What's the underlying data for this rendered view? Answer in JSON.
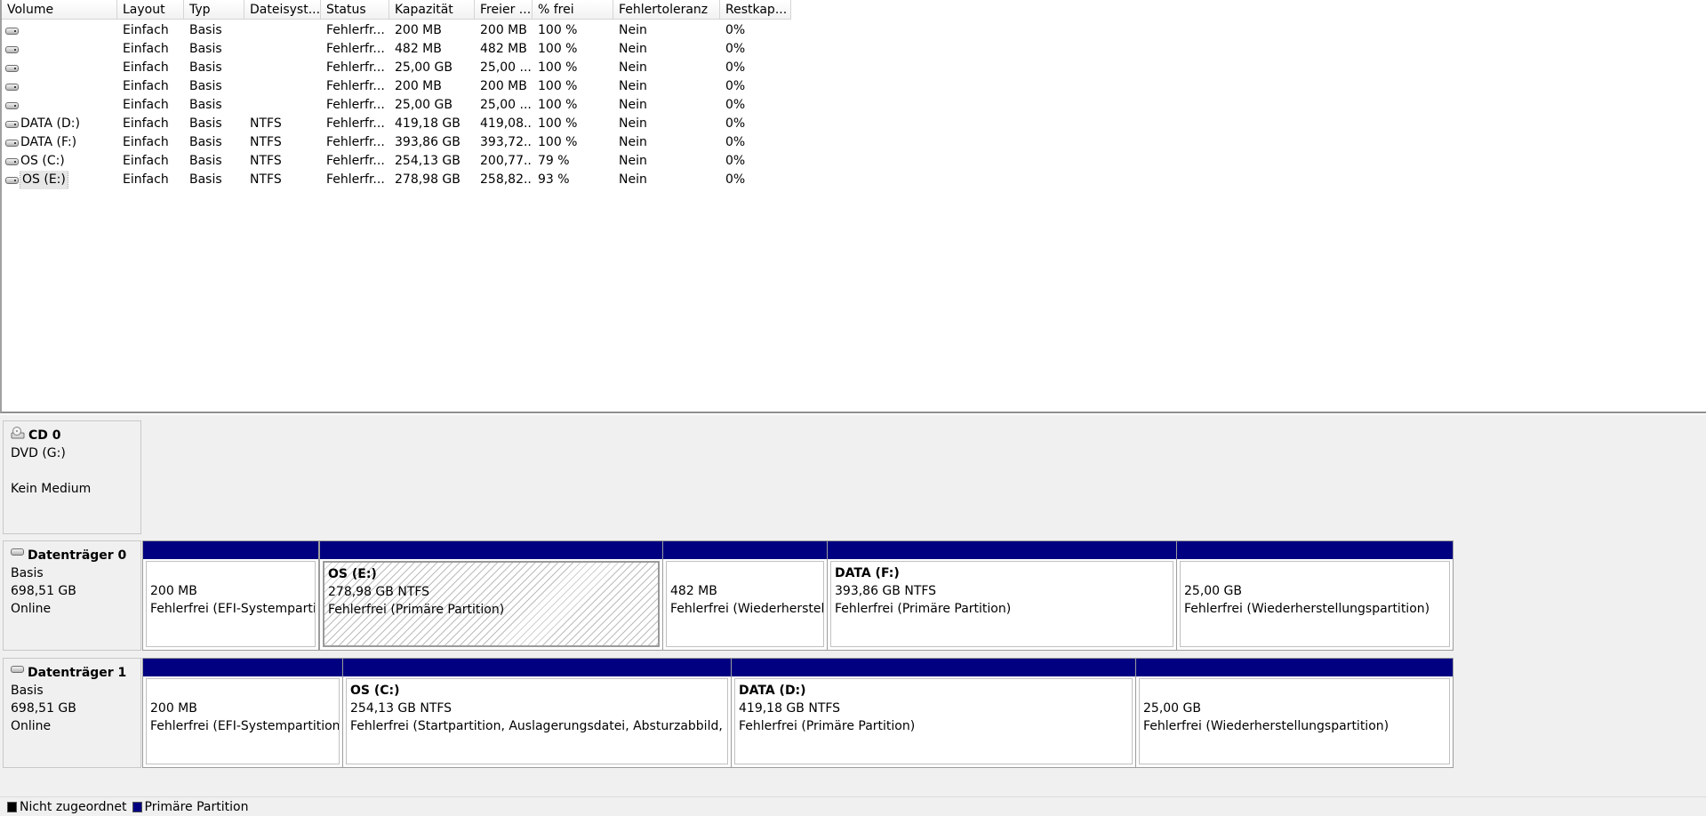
{
  "volume_table": {
    "columns": [
      "Volume",
      "Layout",
      "Typ",
      "Dateisyst...",
      "Status",
      "Kapazität",
      "Freier ...",
      "% frei",
      "Fehlertoleranz",
      "Restkap..."
    ],
    "rows": [
      {
        "volume": "",
        "layout": "Einfach",
        "typ": "Basis",
        "dateisystem": "",
        "status": "Fehlerfr...",
        "kapazitaet": "200 MB",
        "frei": "200 MB",
        "prozent": "100 %",
        "fehlertoleranz": "Nein",
        "restkap": "0%"
      },
      {
        "volume": "",
        "layout": "Einfach",
        "typ": "Basis",
        "dateisystem": "",
        "status": "Fehlerfr...",
        "kapazitaet": "482 MB",
        "frei": "482 MB",
        "prozent": "100 %",
        "fehlertoleranz": "Nein",
        "restkap": "0%"
      },
      {
        "volume": "",
        "layout": "Einfach",
        "typ": "Basis",
        "dateisystem": "",
        "status": "Fehlerfr...",
        "kapazitaet": "25,00 GB",
        "frei": "25,00 ...",
        "prozent": "100 %",
        "fehlertoleranz": "Nein",
        "restkap": "0%"
      },
      {
        "volume": "",
        "layout": "Einfach",
        "typ": "Basis",
        "dateisystem": "",
        "status": "Fehlerfr...",
        "kapazitaet": "200 MB",
        "frei": "200 MB",
        "prozent": "100 %",
        "fehlertoleranz": "Nein",
        "restkap": "0%"
      },
      {
        "volume": "",
        "layout": "Einfach",
        "typ": "Basis",
        "dateisystem": "",
        "status": "Fehlerfr...",
        "kapazitaet": "25,00 GB",
        "frei": "25,00 ...",
        "prozent": "100 %",
        "fehlertoleranz": "Nein",
        "restkap": "0%"
      },
      {
        "volume": "DATA (D:)",
        "layout": "Einfach",
        "typ": "Basis",
        "dateisystem": "NTFS",
        "status": "Fehlerfr...",
        "kapazitaet": "419,18 GB",
        "frei": "419,08...",
        "prozent": "100 %",
        "fehlertoleranz": "Nein",
        "restkap": "0%"
      },
      {
        "volume": "DATA (F:)",
        "layout": "Einfach",
        "typ": "Basis",
        "dateisystem": "NTFS",
        "status": "Fehlerfr...",
        "kapazitaet": "393,86 GB",
        "frei": "393,72...",
        "prozent": "100 %",
        "fehlertoleranz": "Nein",
        "restkap": "0%"
      },
      {
        "volume": "OS (C:)",
        "layout": "Einfach",
        "typ": "Basis",
        "dateisystem": "NTFS",
        "status": "Fehlerfr...",
        "kapazitaet": "254,13 GB",
        "frei": "200,77...",
        "prozent": "79 %",
        "fehlertoleranz": "Nein",
        "restkap": "0%"
      },
      {
        "volume": "OS (E:)",
        "layout": "Einfach",
        "typ": "Basis",
        "dateisystem": "NTFS",
        "status": "Fehlerfr...",
        "kapazitaet": "278,98 GB",
        "frei": "258,82...",
        "prozent": "93 %",
        "fehlertoleranz": "Nein",
        "restkap": "0%",
        "selected": true
      }
    ]
  },
  "disks": [
    {
      "name": "CD 0",
      "lines": [
        "DVD (G:)",
        "",
        "Kein Medium"
      ],
      "icon": "cd-drive-icon",
      "partitions": []
    },
    {
      "name": "Datenträger 0",
      "lines": [
        "Basis",
        "698,51 GB",
        "Online"
      ],
      "icon": "hard-disk-icon",
      "partitions": [
        {
          "title": "",
          "size": "200 MB",
          "status": "Fehlerfrei (EFI-Systempartiti"
        },
        {
          "title": "OS  (E:)",
          "size": "278,98 GB NTFS",
          "status": "Fehlerfrei (Primäre Partition)",
          "selected": true
        },
        {
          "title": "",
          "size": "482 MB",
          "status": "Fehlerfrei (Wiederherstellungspa"
        },
        {
          "title": "DATA  (F:)",
          "size": "393,86 GB NTFS",
          "status": "Fehlerfrei (Primäre Partition)"
        },
        {
          "title": "",
          "size": "25,00 GB",
          "status": "Fehlerfrei (Wiederherstellungspartition)"
        }
      ]
    },
    {
      "name": "Datenträger 1",
      "lines": [
        "Basis",
        "698,51 GB",
        "Online"
      ],
      "icon": "hard-disk-icon",
      "partitions": [
        {
          "title": "",
          "size": "200 MB",
          "status": "Fehlerfrei (EFI-Systempartition)"
        },
        {
          "title": "OS  (C:)",
          "size": "254,13 GB NTFS",
          "status": "Fehlerfrei (Startpartition, Auslagerungsdatei, Absturzabbild, Primäre Partition)"
        },
        {
          "title": "DATA  (D:)",
          "size": "419,18 GB NTFS",
          "status": "Fehlerfrei (Primäre Partition)"
        },
        {
          "title": "",
          "size": "25,00 GB",
          "status": "Fehlerfrei (Wiederherstellungspartition)"
        }
      ]
    }
  ],
  "legend": [
    {
      "label": "Nicht zugeordnet",
      "color": "#000000"
    },
    {
      "label": "Primäre Partition",
      "color": "#000080"
    }
  ],
  "colors": {
    "primary_partition": "#000080",
    "unallocated": "#000000",
    "pane_background": "#f0f0f0"
  }
}
